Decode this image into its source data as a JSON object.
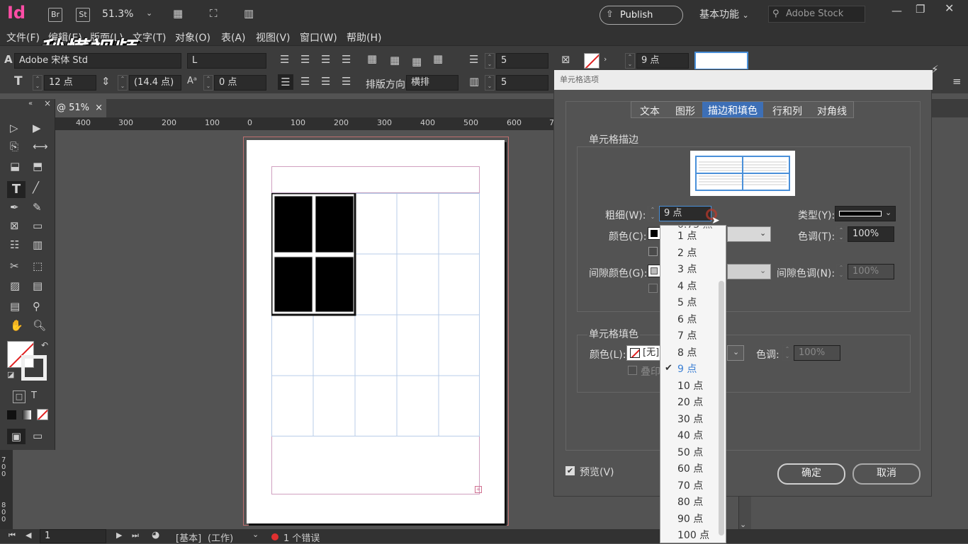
{
  "app": {
    "logo": "Id",
    "bridge_label": "Br",
    "stock_label": "St",
    "zoom": "51.3%",
    "publish_label": "Publish Online",
    "workspace": "基本功能",
    "search_placeholder": "Adobe Stock",
    "watermark": "秒懂视频"
  },
  "menu": [
    "文件(F)",
    "编辑(E)",
    "版面(L)",
    "文字(T)",
    "对象(O)",
    "表(A)",
    "视图(V)",
    "窗口(W)",
    "帮助(H)"
  ],
  "control": {
    "font_family": "Adobe 宋体 Std",
    "font_style": "L",
    "font_size": "12 点",
    "leading": "(14.4 点)",
    "tracking": "0 点",
    "direction_label": "排版方向",
    "direction_value": "横排",
    "rows": "5",
    "cols": "5",
    "stroke_weight": "9 点"
  },
  "doc": {
    "tab_label": "@ 51%",
    "ruler_labels": [
      "400",
      "300",
      "200",
      "100",
      "0",
      "100",
      "200",
      "300",
      "400",
      "500",
      "600",
      "7"
    ],
    "vruler_labels": [
      "700",
      "800"
    ]
  },
  "status": {
    "page": "1",
    "master": "[基本]",
    "mode": "(工作)",
    "errors": "1 个错误"
  },
  "dialog": {
    "title": "单元格选项",
    "tabs": [
      "文本",
      "图形",
      "描边和填色",
      "行和列",
      "对角线"
    ],
    "active_tab": "描边和填色",
    "stroke_section": "单元格描边",
    "weight_label": "粗细(W):",
    "weight_value": "9 点",
    "type_label": "类型(Y):",
    "color_label": "颜色(C):",
    "tint_label": "色调(T):",
    "tint_value": "100%",
    "gap_color_label": "间隙颜色(G):",
    "gap_tint_label": "间隙色调(N):",
    "gap_tint_value": "100%",
    "fill_section": "单元格填色",
    "fill_color_label": "颜色(L):",
    "fill_color_value": "[无]",
    "fill_tint_label": "色调:",
    "fill_tint_value": "100%",
    "overprint_label": "叠印",
    "preview_label": "预览(V)",
    "ok_label": "确定",
    "cancel_label": "取消"
  },
  "dropdown": {
    "partial_top": "0.75 点",
    "options": [
      "1 点",
      "2 点",
      "3 点",
      "4 点",
      "5 点",
      "6 点",
      "7 点",
      "8 点",
      "9 点",
      "10 点",
      "20 点",
      "30 点",
      "40 点",
      "50 点",
      "60 点",
      "70 点",
      "80 点",
      "90 点",
      "100 点"
    ],
    "selected": "9 点"
  },
  "colors": {
    "accent": "#4a90d9",
    "selected_text": "#3b7fd4",
    "dialog_bg": "#535353"
  }
}
